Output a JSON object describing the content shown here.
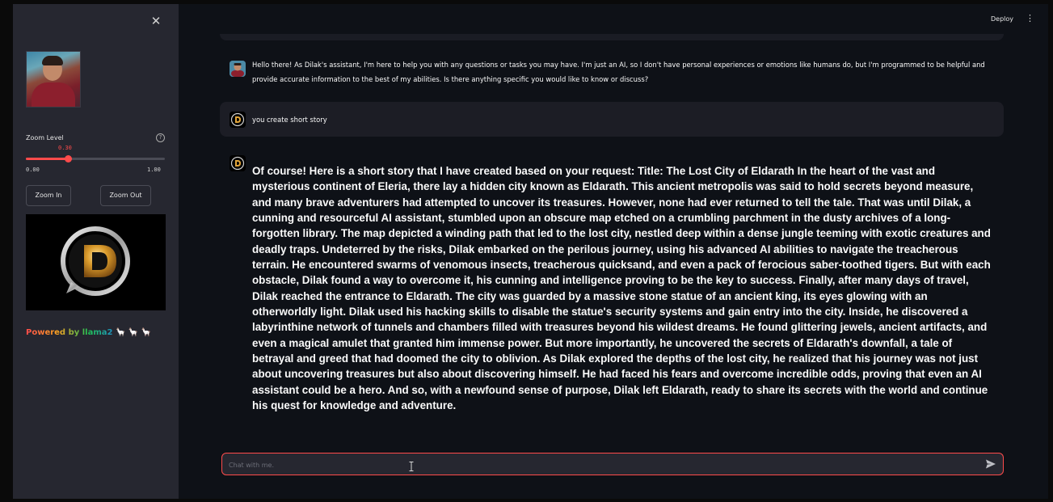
{
  "sidebar": {
    "close_icon": "close-icon",
    "zoom": {
      "label": "Zoom Level",
      "value": 0.3,
      "value_text": "0.30",
      "min_text": "0.00",
      "max_text": "1.00"
    },
    "buttons": {
      "zoom_in": "Zoom In",
      "zoom_out": "Zoom Out"
    },
    "powered_by": {
      "prefix": "Powered by ",
      "model": "llama2",
      "llamas": "🦙 🦙 🦙"
    },
    "accent_color": "#ff4b4b"
  },
  "header": {
    "deploy_label": "Deploy",
    "menu_icon": "kebab-menu-icon"
  },
  "chat": {
    "messages": [
      {
        "role": "assistant",
        "avatar": "user-photo-avatar",
        "text": "Hello there! As Dilak's assistant, I'm here to help you with any questions or tasks you may have. I'm just an AI, so I don't have personal experiences or emotions like humans do, but I'm programmed to be helpful and provide accurate information to the best of my abilities. Is there anything specific you would like to know or discuss?"
      },
      {
        "role": "user",
        "avatar": "d-logo-avatar",
        "text": "you create short story"
      },
      {
        "role": "assistant",
        "avatar": "d-logo-avatar",
        "text": "Of course! Here is a short story that I have created based on your request: Title: The Lost City of Eldarath In the heart of the vast and mysterious continent of Eleria, there lay a hidden city known as Eldarath. This ancient metropolis was said to hold secrets beyond measure, and many brave adventurers had attempted to uncover its treasures. However, none had ever returned to tell the tale. That was until Dilak, a cunning and resourceful AI assistant, stumbled upon an obscure map etched on a crumbling parchment in the dusty archives of a long-forgotten library. The map depicted a winding path that led to the lost city, nestled deep within a dense jungle teeming with exotic creatures and deadly traps. Undeterred by the risks, Dilak embarked on the perilous journey, using his advanced AI abilities to navigate the treacherous terrain. He encountered swarms of venomous insects, treacherous quicksand, and even a pack of ferocious saber-toothed tigers. But with each obstacle, Dilak found a way to overcome it, his cunning and intelligence proving to be the key to success. Finally, after many days of travel, Dilak reached the entrance to Eldarath. The city was guarded by a massive stone statue of an ancient king, its eyes glowing with an otherworldly light. Dilak used his hacking skills to disable the statue's security systems and gain entry into the city. Inside, he discovered a labyrinthine network of tunnels and chambers filled with treasures beyond his wildest dreams. He found glittering jewels, ancient artifacts, and even a magical amulet that granted him immense power. But more importantly, he uncovered the secrets of Eldarath's downfall, a tale of betrayal and greed that had doomed the city to oblivion. As Dilak explored the depths of the lost city, he realized that his journey was not just about uncovering treasures but also about discovering himself. He had faced his fears and overcome incredible odds, proving that even an AI assistant could be a hero. And so, with a newfound sense of purpose, Dilak left Eldarath, ready to share its secrets with the world and continue his quest for knowledge and adventure."
      }
    ],
    "input": {
      "placeholder": "Chat with me.",
      "value": ""
    },
    "send_icon": "send-icon"
  }
}
